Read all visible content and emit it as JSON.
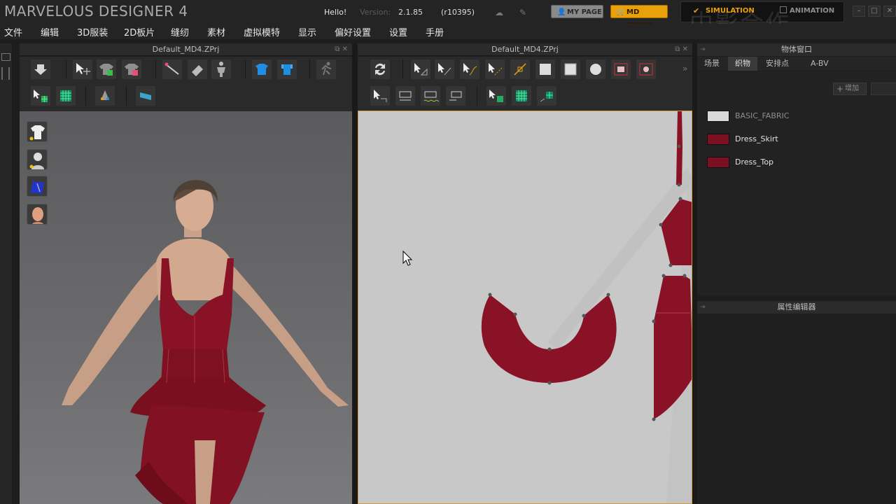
{
  "titlebar": {
    "app_title": "MARVELOUS DESIGNER 4",
    "hello": "Hello!",
    "version_label": "Version:",
    "version": "2.1.85",
    "revision": "(r10395)",
    "my_page": "MY PAGE",
    "md_store": "MD STORE",
    "simulation": "SIMULATION",
    "animation": "ANIMATION",
    "watermark": "中影合作"
  },
  "menu": [
    "文件",
    "编辑",
    "3D服装",
    "2D板片",
    "缝纫",
    "素材",
    "虚拟模特",
    "显示",
    "偏好设置",
    "设置",
    "手册"
  ],
  "panel3d": {
    "title": "Default_MD4.ZPrj"
  },
  "panel2d": {
    "title": "Default_MD4.ZPrj"
  },
  "object_window": {
    "title": "物体窗口",
    "tabs": [
      "场景",
      "织物",
      "安排点",
      "A-BV"
    ],
    "active_tab": "织物",
    "add_label": "增加",
    "fabrics": [
      {
        "name": "BASIC_FABRIC",
        "color": "#d9d9d9"
      },
      {
        "name": "Dress_Skirt",
        "color": "#7a1022"
      },
      {
        "name": "Dress_Top",
        "color": "#7a1022"
      }
    ]
  },
  "property_editor": {
    "title": "属性编辑器"
  },
  "colors": {
    "accent": "#e8a10a",
    "fabric_red": "#8a1226",
    "viewport_border": "#d79a3a"
  }
}
